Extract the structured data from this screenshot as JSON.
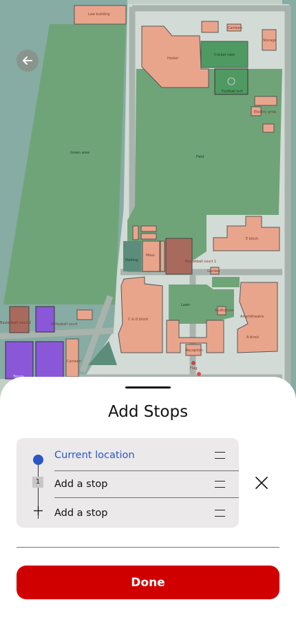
{
  "colors": {
    "accent": "#d10000",
    "current_location": "#2a56c6",
    "field_green": "#6fa479",
    "building": "#e9a58c",
    "court_purple": "#8a57d8"
  },
  "map": {
    "labels": {
      "law_building": "Law building",
      "canteen_top": "Canteen",
      "storage": "Storage",
      "hostel": "Hostel",
      "cricket_nets": "Cricket nets",
      "football_turf": "Football turf",
      "electric_grids": "Electric grids",
      "green_area": "Green area",
      "field": "Field",
      "e_block": "E block",
      "parking": "Parking",
      "mess": "Mess",
      "basketball_court_1": "Basketball court 1",
      "garden": "Garden",
      "lawn": "Lawn",
      "auditorium": "Auditorium",
      "amphitheatre": "Amphitheatre",
      "a_block": "A block",
      "c_d_block": "C & D block",
      "reception": "Reception",
      "flag": "Flag",
      "basketball_court_2": "Basketball court 2",
      "volleyball_court": "Volleyball court",
      "canteen": "Canteen",
      "tennis": "Tennis"
    },
    "back_icon": "arrow-left-icon"
  },
  "sheet": {
    "title": "Add Stops",
    "stops": [
      {
        "label": "Current location",
        "type": "current",
        "icon": "location-dot-icon"
      },
      {
        "label": "Add a stop",
        "type": "numbered",
        "number": "1"
      },
      {
        "label": "Add a stop",
        "type": "add",
        "icon": "plus-icon"
      }
    ],
    "close_icon": "close-icon",
    "drag_icon": "drag-handle-icon",
    "done_label": "Done"
  }
}
